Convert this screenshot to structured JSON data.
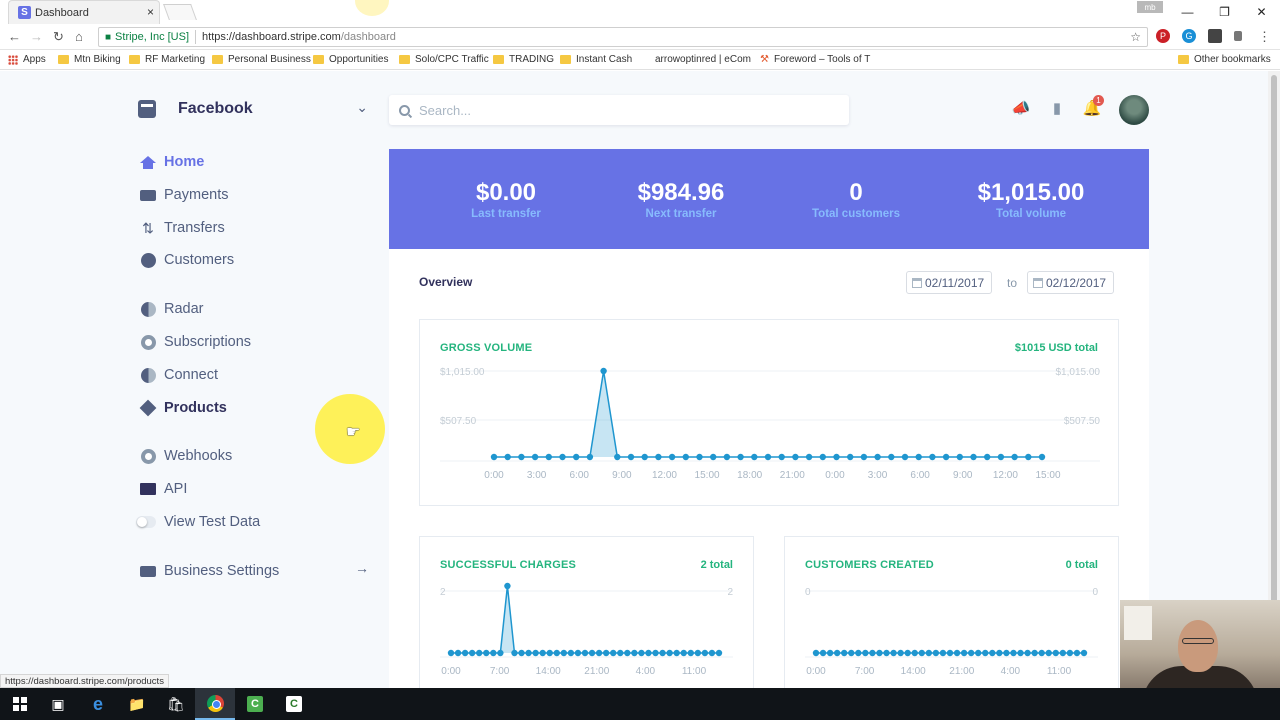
{
  "browser": {
    "tab_title": "Dashboard",
    "tab_favicon": "S",
    "tab_close": "×",
    "profile": "mb",
    "secure_label": "Stripe, Inc [US]",
    "url_host": "https://dashboard.stripe.com",
    "url_path": "/dashboard",
    "bookmarks": [
      "Apps",
      "Mtn Biking",
      "RF Marketing",
      "Personal Business",
      "Opportunities",
      "Solo/CPC Traffic",
      "TRADING",
      "Instant Cash",
      "arrowoptinred | eCom",
      "Foreword – Tools of T",
      "Other bookmarks"
    ],
    "status_url": "https://dashboard.stripe.com/products"
  },
  "account": {
    "name": "Facebook"
  },
  "sidebar": {
    "items": [
      {
        "label": "Home"
      },
      {
        "label": "Payments"
      },
      {
        "label": "Transfers"
      },
      {
        "label": "Customers"
      },
      {
        "label": "Radar"
      },
      {
        "label": "Subscriptions"
      },
      {
        "label": "Connect"
      },
      {
        "label": "Products"
      },
      {
        "label": "Webhooks"
      },
      {
        "label": "API"
      },
      {
        "label": "View Test Data"
      },
      {
        "label": "Business Settings"
      }
    ],
    "active": "Home"
  },
  "search": {
    "placeholder": "Search..."
  },
  "header": {
    "notification_count": "1"
  },
  "stats": [
    {
      "value": "$0.00",
      "label": "Last transfer"
    },
    {
      "value": "$984.96",
      "label": "Next transfer"
    },
    {
      "value": "0",
      "label": "Total customers"
    },
    {
      "value": "$1,015.00",
      "label": "Total volume"
    }
  ],
  "overview": {
    "label": "Overview",
    "date_from": "02/11/2017",
    "date_to_word": "to",
    "date_to": "02/12/2017"
  },
  "colors": {
    "brand": "#6772e5",
    "accent_green": "#24b47e",
    "chart_blue": "#1f96cf"
  },
  "chart_data": [
    {
      "type": "area",
      "title": "GROSS VOLUME",
      "total": "$1015 USD total",
      "x_ticks": [
        "0:00",
        "3:00",
        "6:00",
        "9:00",
        "12:00",
        "15:00",
        "18:00",
        "21:00",
        "0:00",
        "3:00",
        "6:00",
        "9:00",
        "12:00",
        "15:00"
      ],
      "y_ticks": [
        "$1,015.00",
        "$507.50"
      ],
      "ylim": [
        0,
        1015
      ],
      "values": [
        0,
        0,
        0,
        0,
        0,
        0,
        0,
        0,
        1015,
        0,
        0,
        0,
        0,
        0,
        0,
        0,
        0,
        0,
        0,
        0,
        0,
        0,
        0,
        0,
        0,
        0,
        0,
        0,
        0,
        0,
        0,
        0,
        0,
        0,
        0,
        0,
        0,
        0,
        0,
        0,
        0
      ]
    },
    {
      "type": "area",
      "title": "SUCCESSFUL CHARGES",
      "total": "2 total",
      "x_ticks": [
        "0:00",
        "7:00",
        "14:00",
        "21:00",
        "4:00",
        "11:00"
      ],
      "y_ticks": [
        "2"
      ],
      "ylim": [
        0,
        2
      ],
      "values": [
        0,
        0,
        0,
        0,
        0,
        0,
        0,
        0,
        2,
        0,
        0,
        0,
        0,
        0,
        0,
        0,
        0,
        0,
        0,
        0,
        0,
        0,
        0,
        0,
        0,
        0,
        0,
        0,
        0,
        0,
        0,
        0,
        0,
        0,
        0,
        0,
        0,
        0,
        0
      ]
    },
    {
      "type": "area",
      "title": "CUSTOMERS CREATED",
      "total": "0 total",
      "x_ticks": [
        "0:00",
        "7:00",
        "14:00",
        "21:00",
        "4:00",
        "11:00"
      ],
      "y_ticks": [
        "0"
      ],
      "ylim": [
        0,
        1
      ],
      "values": [
        0,
        0,
        0,
        0,
        0,
        0,
        0,
        0,
        0,
        0,
        0,
        0,
        0,
        0,
        0,
        0,
        0,
        0,
        0,
        0,
        0,
        0,
        0,
        0,
        0,
        0,
        0,
        0,
        0,
        0,
        0,
        0,
        0,
        0,
        0,
        0,
        0,
        0,
        0
      ]
    }
  ]
}
